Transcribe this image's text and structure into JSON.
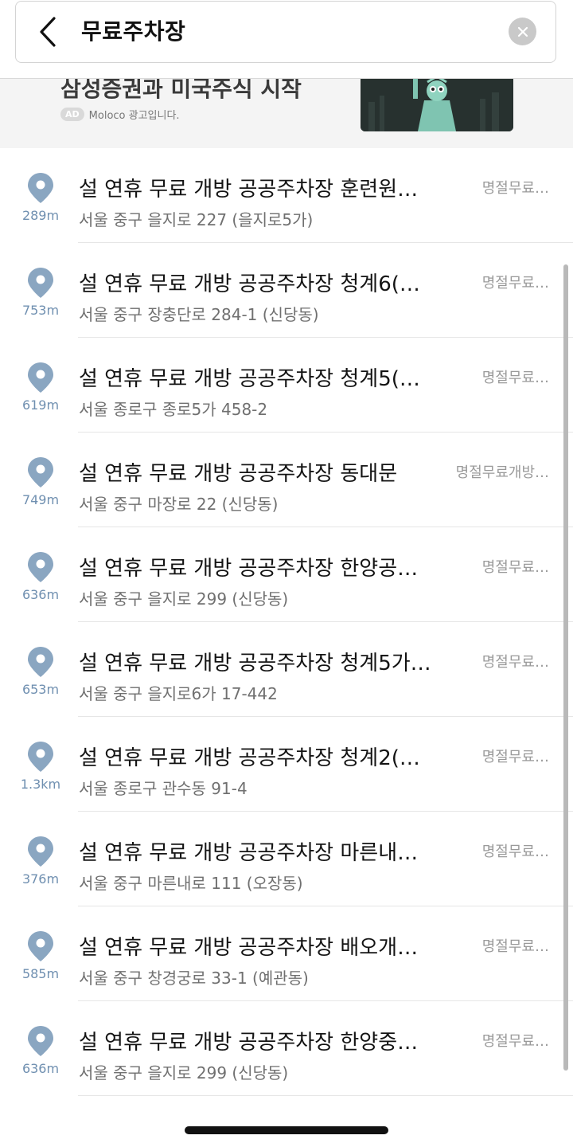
{
  "search": {
    "query": "무료주차장"
  },
  "ad": {
    "title": "삼성증권과 미국주식 시작",
    "badge": "AD",
    "advertiser": "Moloco 광고입니다."
  },
  "results": [
    {
      "distance": "289m",
      "title": "설 연휴 무료 개방 공공주차장 훈련원…",
      "tag": "명절무료…",
      "address": "서울 중구 을지로 227 (을지로5가)"
    },
    {
      "distance": "753m",
      "title": "설 연휴 무료 개방 공공주차장 청계6(…",
      "tag": "명절무료…",
      "address": "서울 중구 장충단로 284-1 (신당동)"
    },
    {
      "distance": "619m",
      "title": "설 연휴 무료 개방 공공주차장 청계5(…",
      "tag": "명절무료…",
      "address": "서울 종로구 종로5가 458-2"
    },
    {
      "distance": "749m",
      "title": "설 연휴 무료 개방 공공주차장 동대문",
      "tag": "명절무료개방…",
      "address": "서울 중구 마장로 22 (신당동)"
    },
    {
      "distance": "636m",
      "title": "설 연휴 무료 개방 공공주차장 한양공…",
      "tag": "명절무료…",
      "address": "서울 중구 을지로 299 (신당동)"
    },
    {
      "distance": "653m",
      "title": "설 연휴 무료 개방 공공주차장 청계5가…",
      "tag": "명절무료…",
      "address": "서울 중구 을지로6가 17-442"
    },
    {
      "distance": "1.3km",
      "title": "설 연휴 무료 개방 공공주차장 청계2(…",
      "tag": "명절무료…",
      "address": "서울 종로구 관수동 91-4"
    },
    {
      "distance": "376m",
      "title": "설 연휴 무료 개방 공공주차장 마른내…",
      "tag": "명절무료…",
      "address": "서울 중구 마른내로 111 (오장동)"
    },
    {
      "distance": "585m",
      "title": "설 연휴 무료 개방 공공주차장 배오개…",
      "tag": "명절무료…",
      "address": "서울 중구 창경궁로 33-1 (예관동)"
    },
    {
      "distance": "636m",
      "title": "설 연휴 무료 개방 공공주차장 한양중…",
      "tag": "명절무료…",
      "address": "서울 중구 을지로 299 (신당동)"
    }
  ],
  "colors": {
    "pin": "#8aa6c1",
    "distance": "#6f8fb0"
  }
}
